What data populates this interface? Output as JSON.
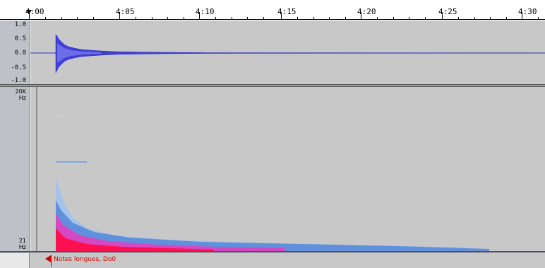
{
  "timeline": {
    "ticks": [
      "4:00",
      "4:05",
      "4:10",
      "4:15",
      "4:20",
      "4:25",
      "4:30"
    ]
  },
  "waveform": {
    "amplitude_labels": [
      "1.0",
      "0.5",
      "0.0",
      "-0.5",
      "-1.0"
    ],
    "color": "#3333cc"
  },
  "spectrogram": {
    "top_label": "20K\nHz",
    "bottom_label": "21\nHz"
  },
  "label_track": {
    "label_text": "Notes longues, Do0",
    "color": "#cc0000"
  }
}
